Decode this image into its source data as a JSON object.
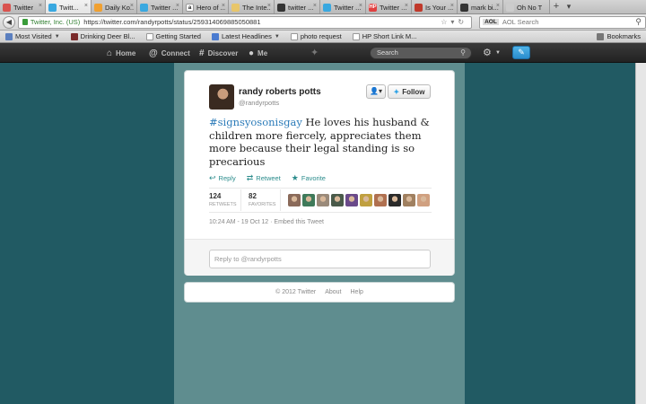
{
  "browser": {
    "tabs": [
      {
        "label": "Twitter",
        "color": "#d9534f",
        "glyph": ""
      },
      {
        "label": "Twitt...",
        "color": "#39a8e0",
        "glyph": "",
        "active": true
      },
      {
        "label": "Daily Ko...",
        "color": "#f0a030",
        "glyph": ""
      },
      {
        "label": "Twitter ...",
        "color": "#39a8e0",
        "glyph": ""
      },
      {
        "label": "Hero of ...",
        "color": "#ffffff",
        "glyph": "a"
      },
      {
        "label": "The Inte...",
        "color": "#e8c66a",
        "glyph": ""
      },
      {
        "label": "twitter ...",
        "color": "#333333",
        "glyph": ""
      },
      {
        "label": "Twitter ...",
        "color": "#39a8e0",
        "glyph": ""
      },
      {
        "label": "Twitter ...",
        "color": "#e04040",
        "glyph": "HP"
      },
      {
        "label": "Is Your ...",
        "color": "#c0392b",
        "glyph": ""
      },
      {
        "label": "mark bi...",
        "color": "#333333",
        "glyph": ""
      },
      {
        "label": "Oh No T",
        "color": "#cccccc",
        "glyph": ""
      }
    ],
    "new_tab_symbol": "+",
    "tab_list_symbol": "▾",
    "identity": "Twitter, Inc. (US)",
    "url": "https://twitter.com/randyrpotts/status/259314069885050881",
    "search_engine": "AOL",
    "search_placeholder": "AOL Search",
    "bookmarks": [
      {
        "label": "Most Visited",
        "color": "#5b7fbf",
        "dropdown": true
      },
      {
        "label": "Drinking Deer Bl...",
        "color": "#7a2b2b",
        "dropdown": false
      },
      {
        "label": "Getting Started",
        "color": "#ffffff",
        "dropdown": false
      },
      {
        "label": "Latest Headlines",
        "color": "#4a7bd0",
        "dropdown": true
      },
      {
        "label": "photo request",
        "color": "#ffffff",
        "dropdown": false
      },
      {
        "label": "HP Short Link M...",
        "color": "#ffffff",
        "dropdown": false
      }
    ],
    "bookmarks_menu": "Bookmarks"
  },
  "topbar": {
    "home": "Home",
    "connect": "Connect",
    "discover": "Discover",
    "me": "Me",
    "search_placeholder": "Search"
  },
  "tweet": {
    "fullname": "randy roberts potts",
    "screenname": "@randyrpotts",
    "follow_label": "Follow",
    "hashtag": "#signsyosonisgay",
    "text": " He loves his husband & children more fiercely, appreciates them more because their legal standing is so precarious",
    "actions": {
      "reply": "Reply",
      "retweet": "Retweet",
      "favorite": "Favorite"
    },
    "retweets_count": "124",
    "retweets_label": "RETWEETS",
    "favorites_count": "82",
    "favorites_label": "FAVORITES",
    "favoriter_colors": [
      "#8a6a5a",
      "#3f7a5a",
      "#9a8a7a",
      "#4a5a4a",
      "#6a4a8a",
      "#c0a040",
      "#b07050",
      "#2a2a2a",
      "#a08060",
      "#d0a080"
    ],
    "timestamp": "10:24 AM - 19 Oct 12",
    "separator": "·",
    "embed_label": "Embed this Tweet",
    "reply_placeholder": "Reply to @randyrpotts"
  },
  "footer": {
    "copyright": "© 2012 Twitter",
    "about": "About",
    "help": "Help"
  },
  "colors": {
    "page_background": "#215a63",
    "column_background": "#5f8d8f",
    "link": "#2b7bb9",
    "action": "#2b8c8c"
  }
}
